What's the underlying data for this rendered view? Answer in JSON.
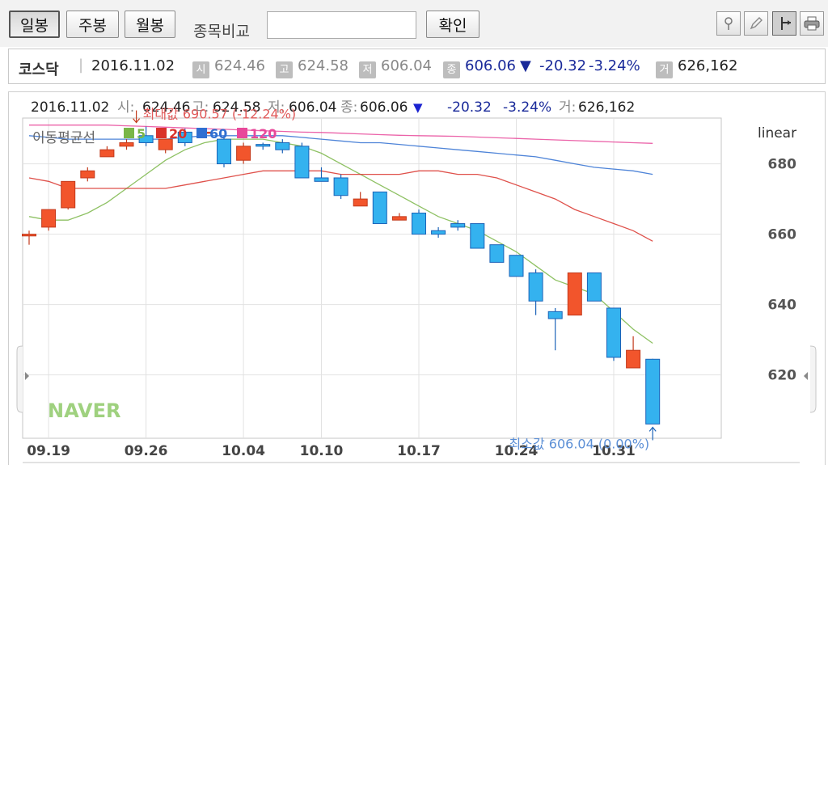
{
  "toolbar": {
    "period_buttons": [
      {
        "label": "일봉",
        "active": true
      },
      {
        "label": "주봉",
        "active": false
      },
      {
        "label": "월봉",
        "active": false
      }
    ],
    "compare_label": "종목비교",
    "compare_value": "",
    "confirm_label": "확인",
    "tools": [
      "pin-icon",
      "pen-icon",
      "crosshair-icon",
      "printer-icon"
    ]
  },
  "summary": {
    "market": "코스닥",
    "date": "2016.11.02",
    "open_badge": "시",
    "open": "624.46",
    "high_badge": "고",
    "high": "624.58",
    "low_badge": "저",
    "low": "606.04",
    "close_badge": "종",
    "close": "606.06",
    "change_arrow": "▼",
    "change": "-20.32",
    "change_pct": "-3.24%",
    "volume_badge": "거",
    "volume": "626,162"
  },
  "chart_header": {
    "date": "2016.11.02",
    "open_label": "시:",
    "open": "624.46",
    "high_label": "고:",
    "high": "624.58",
    "low_label": "저:",
    "low": "606.04",
    "close_label": "종:",
    "close": "606.06",
    "arrow": "▼",
    "change": "-20.32",
    "change_pct": "-3.24%",
    "volume_label": "거:",
    "volume": "626,162"
  },
  "legend": {
    "title": "이동평균선",
    "items": [
      {
        "label": "5",
        "color": "#7ab648"
      },
      {
        "label": "20",
        "color": "#d9322b"
      },
      {
        "label": "60",
        "color": "#2f6fd1"
      },
      {
        "label": "120",
        "color": "#e8489a"
      }
    ]
  },
  "scale_label": "linear",
  "watermark": "NAVER",
  "colors": {
    "up": "#f2552c",
    "down": "#34b2ef",
    "up_edge": "#c33a1c",
    "down_edge": "#1b63b8",
    "grid": "#e2e2e2"
  },
  "chart_data": {
    "type": "candlestick",
    "ylim": [
      602,
      693
    ],
    "yticks": [
      620,
      640,
      660,
      680
    ],
    "xtick_labels": [
      {
        "index": 1,
        "label": "09.19"
      },
      {
        "index": 6,
        "label": "09.26"
      },
      {
        "index": 11,
        "label": "10.04"
      },
      {
        "index": 15,
        "label": "10.10"
      },
      {
        "index": 20,
        "label": "10.17"
      },
      {
        "index": 25,
        "label": "10.24"
      },
      {
        "index": 30,
        "label": "10.31"
      }
    ],
    "candles": [
      {
        "o": 659.5,
        "h": 661,
        "l": 657,
        "c": 660
      },
      {
        "o": 662,
        "h": 667,
        "l": 661,
        "c": 667
      },
      {
        "o": 667.5,
        "h": 675,
        "l": 667,
        "c": 675
      },
      {
        "o": 676,
        "h": 679,
        "l": 675,
        "c": 678
      },
      {
        "o": 682,
        "h": 685,
        "l": 682,
        "c": 684
      },
      {
        "o": 685,
        "h": 687,
        "l": 684,
        "c": 686
      },
      {
        "o": 688,
        "h": 690.57,
        "l": 685,
        "c": 686
      },
      {
        "o": 684,
        "h": 687,
        "l": 683,
        "c": 687
      },
      {
        "o": 689,
        "h": 690,
        "l": 685,
        "c": 686
      },
      {
        "o": 689,
        "h": 690,
        "l": 688,
        "c": 689
      },
      {
        "o": 687,
        "h": 688,
        "l": 679,
        "c": 680
      },
      {
        "o": 681,
        "h": 686,
        "l": 680,
        "c": 685
      },
      {
        "o": 685.5,
        "h": 686,
        "l": 684,
        "c": 685
      },
      {
        "o": 686,
        "h": 687,
        "l": 683,
        "c": 684
      },
      {
        "o": 685,
        "h": 686,
        "l": 676,
        "c": 676
      },
      {
        "o": 676,
        "h": 679,
        "l": 675,
        "c": 675
      },
      {
        "o": 676,
        "h": 677,
        "l": 670,
        "c": 671
      },
      {
        "o": 668,
        "h": 672,
        "l": 668,
        "c": 670
      },
      {
        "o": 672,
        "h": 672,
        "l": 663,
        "c": 663
      },
      {
        "o": 664,
        "h": 666,
        "l": 664,
        "c": 665
      },
      {
        "o": 666,
        "h": 667,
        "l": 660,
        "c": 660
      },
      {
        "o": 661,
        "h": 662,
        "l": 659,
        "c": 660
      },
      {
        "o": 663,
        "h": 664,
        "l": 661,
        "c": 662
      },
      {
        "o": 663,
        "h": 663,
        "l": 656,
        "c": 656
      },
      {
        "o": 657,
        "h": 657,
        "l": 652,
        "c": 652
      },
      {
        "o": 654,
        "h": 654,
        "l": 648,
        "c": 648
      },
      {
        "o": 649,
        "h": 650,
        "l": 637,
        "c": 641
      },
      {
        "o": 638,
        "h": 639,
        "l": 627,
        "c": 636
      },
      {
        "o": 637,
        "h": 649,
        "l": 637,
        "c": 649
      },
      {
        "o": 649,
        "h": 649,
        "l": 641,
        "c": 641
      },
      {
        "o": 639,
        "h": 639,
        "l": 624,
        "c": 625
      },
      {
        "o": 622,
        "h": 631,
        "l": 622,
        "c": 627
      },
      {
        "o": 624.46,
        "h": 624.58,
        "l": 606.04,
        "c": 606.06
      }
    ],
    "moving_averages": [
      {
        "name": "5",
        "values": [
          665,
          664,
          664,
          666,
          669,
          673,
          677,
          681,
          684,
          686,
          687,
          687,
          687,
          686,
          685,
          683,
          680,
          677,
          674,
          671,
          668,
          665,
          663,
          661,
          658,
          655,
          651,
          647,
          645,
          643,
          638,
          633,
          629
        ]
      },
      {
        "name": "20",
        "values": [
          676,
          675,
          673,
          673,
          673,
          673,
          673,
          673,
          674,
          675,
          676,
          677,
          678,
          678,
          678,
          678,
          677,
          677,
          677,
          677,
          678,
          678,
          677,
          677,
          676,
          674,
          672,
          670,
          667,
          665,
          663,
          661,
          658
        ]
      },
      {
        "name": "60",
        "values": [
          688,
          687.5,
          687,
          687,
          687,
          687,
          687,
          687,
          687.5,
          688,
          688,
          688,
          688,
          688,
          687.5,
          687,
          686.5,
          686,
          686,
          685.5,
          685,
          684.5,
          684,
          683.5,
          683,
          682.5,
          682,
          681,
          680,
          679,
          678.5,
          678,
          677
        ]
      },
      {
        "name": "120",
        "values": [
          691,
          691,
          691,
          691,
          691,
          690.8,
          690.6,
          690.4,
          690.2,
          690,
          689.8,
          689.6,
          689.4,
          689.2,
          689,
          688.9,
          688.7,
          688.5,
          688.3,
          688.1,
          688,
          687.9,
          687.8,
          687.6,
          687.4,
          687.2,
          687,
          686.8,
          686.6,
          686.4,
          686.2,
          686,
          685.8
        ]
      }
    ],
    "annotations": {
      "max_text": "최대값 690.57 (-12.24%)",
      "min_text": "최소값 606.04 (0.00%)"
    }
  }
}
